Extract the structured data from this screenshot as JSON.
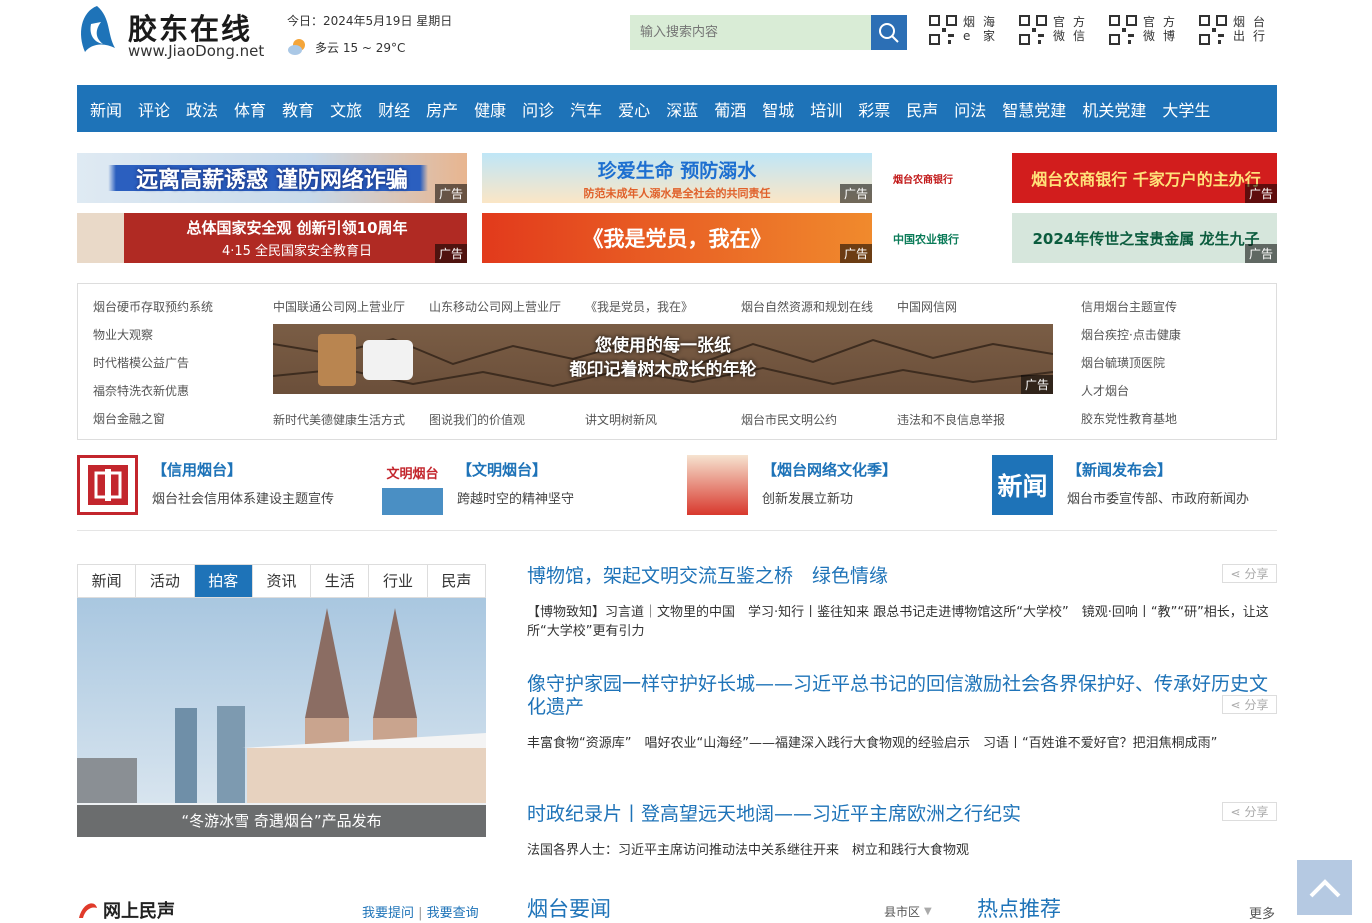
{
  "header": {
    "logo_text": "胶东在线",
    "logo_url": "www.JiaoDong.net",
    "date": "今日：2024年5月19日 星期日",
    "weather": "多云 15 ~ 29°C",
    "search_placeholder": "输入搜索内容",
    "qr_links": [
      {
        "label": [
          "烟",
          "海",
          "e",
          "家"
        ]
      },
      {
        "label": [
          "官",
          "方",
          "微",
          "信"
        ]
      },
      {
        "label": [
          "官",
          "方",
          "微",
          "博"
        ]
      },
      {
        "label": [
          "烟",
          "台",
          "出",
          "行"
        ]
      }
    ]
  },
  "nav": [
    "新闻",
    "评论",
    "政法",
    "体育",
    "教育",
    "文旅",
    "财经",
    "房产",
    "健康",
    "问诊",
    "汽车",
    "爱心",
    "深蓝",
    "葡酒",
    "智城",
    "培训",
    "彩票",
    "民声",
    "问法",
    "智慧党建",
    "机关党建",
    "大学生"
  ],
  "ads": {
    "tag": "广告",
    "row1": [
      "远离高薪诱惑 谨防网络诈骗",
      "珍爱生命 预防溺水",
      "烟台农商银行 千家万户的主办行"
    ],
    "row1_sub": [
      "",
      "防范未成年人溺水是全社会的共同责任",
      ""
    ],
    "row2": [
      "总体国家安全观 创新引领10周年",
      "《我是党员，我在》",
      "2024年传世之宝贵金属 龙生九子"
    ],
    "row2_sub": [
      "4·15 全民国家安全教育日",
      "",
      ""
    ],
    "bank1": "烟台农商银行",
    "bank2": "中国农业银行"
  },
  "links": {
    "left": [
      "烟台硬币存取预约系统",
      "物业大观察",
      "时代楷模公益广告",
      "福奈特洗衣新优惠",
      "烟台金融之窗"
    ],
    "top": [
      "中国联通公司网上营业厅",
      "山东移动公司网上营业厅",
      "《我是党员，我在》",
      "烟台自然资源和规划在线",
      "中国网信网"
    ],
    "bottom": [
      "新时代美德健康生活方式",
      "图说我们的价值观",
      "讲文明树新风",
      "烟台市民文明公约",
      "违法和不良信息举报"
    ],
    "right": [
      "信用烟台主题宣传",
      "烟台疾控·点击健康",
      "烟台毓璜顶医院",
      "人才烟台",
      "胶东党性教育基地"
    ],
    "banner_line1": "您使用的每一张纸",
    "banner_line2": "都印记着树木成长的年轮"
  },
  "promos": [
    {
      "title": "【信用烟台】",
      "desc": "烟台社会信用体系建设主题宣传"
    },
    {
      "title": "【文明烟台】",
      "desc": "跨越时空的精神坚守"
    },
    {
      "title": "【烟台网络文化季】",
      "desc": "创新发展立新功"
    },
    {
      "title": "【新闻发布会】",
      "desc": "烟台市委宣传部、市政府新闻办"
    }
  ],
  "promo_icons": {
    "p4": "新闻",
    "p2": "文明烟台"
  },
  "tabs": [
    "新闻",
    "活动",
    "拍客",
    "资讯",
    "生活",
    "行业",
    "民声"
  ],
  "photo_caption": "“冬游冰雪 奇遇烟台”产品发布",
  "news": [
    {
      "title": "博物馆，架起文明交流互鉴之桥　绿色情缘",
      "sub": "【博物致知】习言道｜文物里的中国　学习·知行丨鉴往知来 跟总书记走进博物馆这所“大学校”　镜观·回响丨“教”“研”相长，让这所“大学校”更有引力"
    },
    {
      "title": "像守护家园一样守护好长城——习近平总书记的回信激励社会各界保护好、传承好历史文化遗产",
      "sub": "丰富食物“资源库”　唱好农业“山海经”——福建深入践行大食物观的经验启示　习语丨“百姓谁不爱好官？把泪焦桐成雨”"
    },
    {
      "title": "时政纪录片丨登高望远天地阔——习近平主席欧洲之行纪实",
      "sub": "法国各界人士：习近平主席访问推动法中关系继往开来　树立和践行大食物观"
    }
  ],
  "share_label": "分享",
  "bottom": {
    "minsheng": "网上民声",
    "ask": "我要提问",
    "query": "我要查询",
    "yaowen": "烟台要闻",
    "county": "县市区",
    "hot": "热点推荐",
    "more": "更多"
  }
}
